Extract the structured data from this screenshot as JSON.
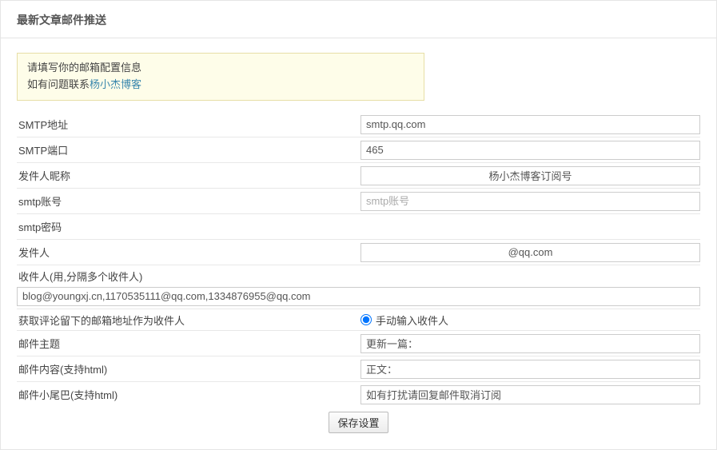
{
  "header": {
    "title": "最新文章邮件推送"
  },
  "notice": {
    "line1": "请填写你的邮箱配置信息",
    "line2_prefix": "如有问题联系",
    "line2_link": "杨小杰博客"
  },
  "fields": {
    "smtp_addr": {
      "label": "SMTP地址",
      "value": "smtp.qq.com"
    },
    "smtp_port": {
      "label": "SMTP端口",
      "value": "465"
    },
    "sender_nick": {
      "label": "发件人昵称",
      "value": "杨小杰博客订阅号"
    },
    "smtp_user": {
      "label": "smtp账号",
      "value": "",
      "placeholder": "smtp账号"
    },
    "smtp_pass": {
      "label": "smtp密码",
      "value": ""
    },
    "sender": {
      "label": "发件人",
      "value": "@qq.com"
    },
    "recipients": {
      "label": "收件人(用,分隔多个收件人)",
      "value": "blog@youngxj.cn,1170535111@qq.com,1334876955@qq.com"
    },
    "source": {
      "label": "获取评论留下的邮箱地址作为收件人",
      "radio_label": "手动输入收件人"
    },
    "subject": {
      "label": "邮件主题",
      "value": "更新一篇："
    },
    "content": {
      "label": "邮件内容(支持html)",
      "value": "正文："
    },
    "footer": {
      "label": "邮件小尾巴(支持html)",
      "value": "如有打扰请回复邮件取消订阅"
    }
  },
  "actions": {
    "save": "保存设置"
  }
}
